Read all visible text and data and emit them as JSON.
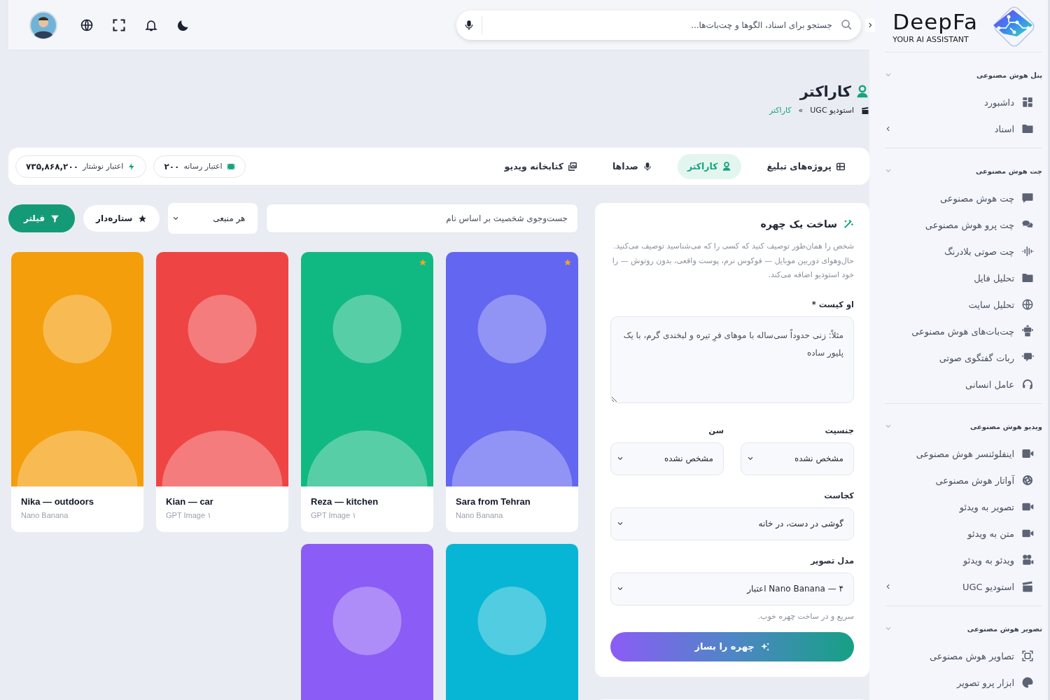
{
  "sidebar": {
    "brand": {
      "name": "DeepFa",
      "tagline": "YOUR AI ASSISTANT"
    },
    "sections": [
      {
        "title": "پنل هوش مصنوعی",
        "items": [
          {
            "label": "داشبورد",
            "has_submenu": false
          },
          {
            "label": "اسناد",
            "has_submenu": true
          }
        ]
      },
      {
        "title": "چت هوش مصنوعی",
        "items": [
          {
            "label": "چت هوش مصنوعی",
            "has_submenu": false
          },
          {
            "label": "چت پرو هوش مصنوعی",
            "has_submenu": false
          },
          {
            "label": "چت صوتی بلادرنگ",
            "has_submenu": false
          },
          {
            "label": "تحلیل فایل",
            "has_submenu": false
          },
          {
            "label": "تحلیل سایت",
            "has_submenu": false
          },
          {
            "label": "چت‌بات‌های هوش مصنوعی",
            "has_submenu": false
          },
          {
            "label": "ربات گفتگوی صوتی",
            "has_submenu": false
          },
          {
            "label": "عامل انسانی",
            "has_submenu": false
          }
        ]
      },
      {
        "title": "ویدیو هوش مصنوعی",
        "items": [
          {
            "label": "اینفلوئنسر هوش مصنوعی",
            "has_submenu": false
          },
          {
            "label": "آواتار هوش مصنوعی",
            "has_submenu": false
          },
          {
            "label": "تصویر به ویدئو",
            "has_submenu": false
          },
          {
            "label": "متن به ویدئو",
            "has_submenu": false
          },
          {
            "label": "ویدئو به ویدئو",
            "has_submenu": false
          },
          {
            "label": "استودیو UGC",
            "has_submenu": true
          }
        ]
      },
      {
        "title": "تصویر هوش مصنوعی",
        "items": [
          {
            "label": "تصاویر هوش مصنوعی",
            "has_submenu": false
          },
          {
            "label": "ابزار پرو تصویر",
            "has_submenu": false
          }
        ]
      }
    ]
  },
  "topbar": {
    "search": {
      "placeholder": "جستجو برای اسناد، الگوها و چت‌بات‌ها..."
    }
  },
  "header": {
    "title": "کاراکتر",
    "breadcrumbs": [
      {
        "label": "استودیو UGC",
        "selected": false
      },
      {
        "label": "کاراکتر",
        "selected": true
      }
    ],
    "separator": "»"
  },
  "tabs": [
    {
      "label": "پروژه‌های تبلیغ",
      "selected": false
    },
    {
      "label": "کاراکتر",
      "selected": true
    },
    {
      "label": "صداها",
      "selected": false
    },
    {
      "label": "کتابخانه ویدیو",
      "selected": false
    }
  ],
  "credits": [
    {
      "label": "اعتبار رسانه",
      "value": "۲۰۰"
    },
    {
      "label": "اعتبار نوشتار",
      "value": "۷۳۵,۸۶۸,۲۰۰"
    }
  ],
  "form": {
    "title": "ساخت یک چهره",
    "description": "شخص را همان‌طور توصیف کنید که کسی را که می‌شناسید توصیف می‌کنید. حال‌وهوای دوربین موبایل — فوکوس نرم، پوست واقعی، بدون روتوش — را خود استودیو اضافه می‌کند.",
    "rows": [
      [
        {
          "kind": "textarea",
          "label": "او کیست *",
          "placeholder": "مثلاً: زنی حدوداً سی‌ساله با موهای فرِ تیره و لبخندی گرم، با یک پلیور ساده"
        }
      ],
      [
        {
          "kind": "select",
          "label": "جنسیت",
          "value": "مشخص نشده"
        },
        {
          "kind": "select",
          "label": "سن",
          "value": "مشخص نشده"
        }
      ],
      [
        {
          "kind": "select",
          "label": "کجاست",
          "value": "گوشی در دست، در خانه"
        }
      ],
      [
        {
          "kind": "select",
          "label": "مدل تصویر",
          "value": "Nano Banana — ۴ اعتبار",
          "hint": "سریع و در ساخت چهره خوب."
        }
      ]
    ],
    "submit": "چهره را بساز"
  },
  "filters": {
    "search": {
      "placeholder": "جست‌وجوی شخصیت بر اساس نام"
    },
    "source": {
      "value": "هر منبعی"
    },
    "starred": {
      "label": "ستاره‌دار",
      "selected": false
    },
    "filter_button": "فیلتر"
  },
  "cards": [
    {
      "name": "Sara from Tehran",
      "source": "Nano Banana",
      "color": "#6366f1",
      "starred": true
    },
    {
      "name": "Reza — kitchen",
      "source": "GPT Image ۱",
      "color": "#10b981",
      "starred": true
    },
    {
      "name": "Kian — car",
      "source": "GPT Image ۱",
      "color": "#ef4444",
      "starred": false
    },
    {
      "name": "Nika — outdoors",
      "source": "Nano Banana",
      "color": "#f59e0b",
      "starred": false
    },
    {
      "color": "#06b6d4",
      "starred": false
    },
    {
      "color": "#8b5cf6",
      "starred": false
    }
  ]
}
